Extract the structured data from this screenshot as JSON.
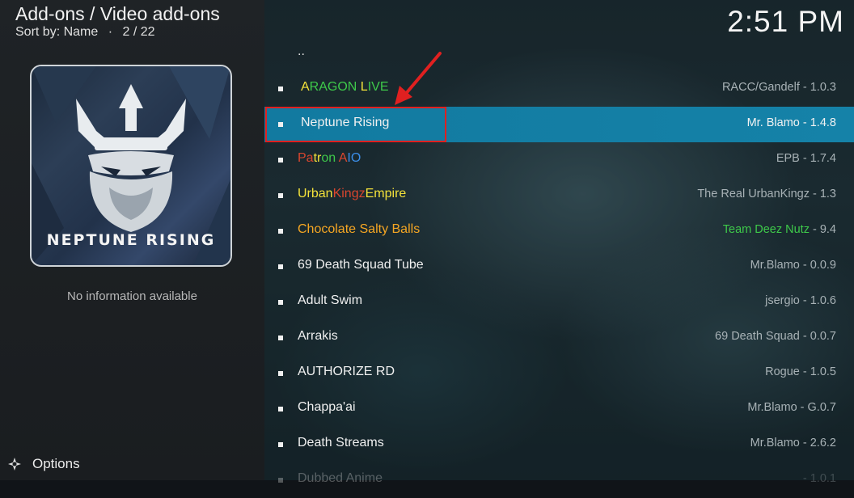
{
  "header": {
    "title": "Add-ons / Video add-ons",
    "sort_label": "Sort by: Name",
    "separator": "·",
    "position": "2 / 22"
  },
  "clock": "2:51 PM",
  "thumbnail": {
    "title": "NEPTUNE RISING"
  },
  "info_text": "No information available",
  "options_label": "Options",
  "parent_item": "..",
  "list": {
    "items": [
      {
        "name_parts": [
          {
            "text": "A",
            "color": "#f4e23a"
          },
          {
            "text": "RAGON ",
            "color": "#3ec94a"
          },
          {
            "text": "L",
            "color": "#f4e23a"
          },
          {
            "text": "IVE",
            "color": "#3ec94a"
          }
        ],
        "meta": "RACC/Gandelf - 1.0.3"
      },
      {
        "name": "Neptune Rising",
        "meta": "Mr. Blamo - 1.4.8",
        "selected": true
      },
      {
        "name_parts": [
          {
            "text": "Pa",
            "color": "#d9462e"
          },
          {
            "text": "tr",
            "color": "#f4e23a"
          },
          {
            "text": "on",
            "color": "#3ec94a"
          },
          {
            "text": " A",
            "color": "#d9462e"
          },
          {
            "text": "IO",
            "color": "#3b8ee8"
          }
        ],
        "meta": "EPB - 1.7.4"
      },
      {
        "name_parts": [
          {
            "text": "Urban",
            "color": "#f4e23a"
          },
          {
            "text": "Kingz",
            "color": "#d9462e"
          },
          {
            "text": "Empire",
            "color": "#f4e23a"
          }
        ],
        "meta": "The Real UrbanKingz - 1.3"
      },
      {
        "name_parts": [
          {
            "text": "Chocolate Salty Balls",
            "color": "#f5a623"
          }
        ],
        "meta_parts": [
          {
            "text": "Team Deez Nutz",
            "color": "#3ec94a"
          },
          {
            "text": " - 9.4",
            "color": "#a8b2b6"
          }
        ]
      },
      {
        "name": "69 Death Squad Tube",
        "meta": "Mr.Blamo - 0.0.9"
      },
      {
        "name": "Adult Swim",
        "meta": "jsergio - 1.0.6"
      },
      {
        "name": "Arrakis",
        "meta": "69 Death Squad - 0.0.7"
      },
      {
        "name": "AUTHORIZE RD",
        "meta": "Rogue - 1.0.5"
      },
      {
        "name": "Chappa'ai",
        "meta": "Mr.Blamo - G.0.7"
      },
      {
        "name": "Death Streams",
        "meta": "Mr.Blamo - 2.6.2"
      },
      {
        "name": "Dubbed Anime",
        "meta": "- 1.0.1"
      }
    ]
  },
  "colors": {
    "selection": "#1582a8",
    "highlight_box": "#e02020",
    "arrow": "#e02020"
  }
}
